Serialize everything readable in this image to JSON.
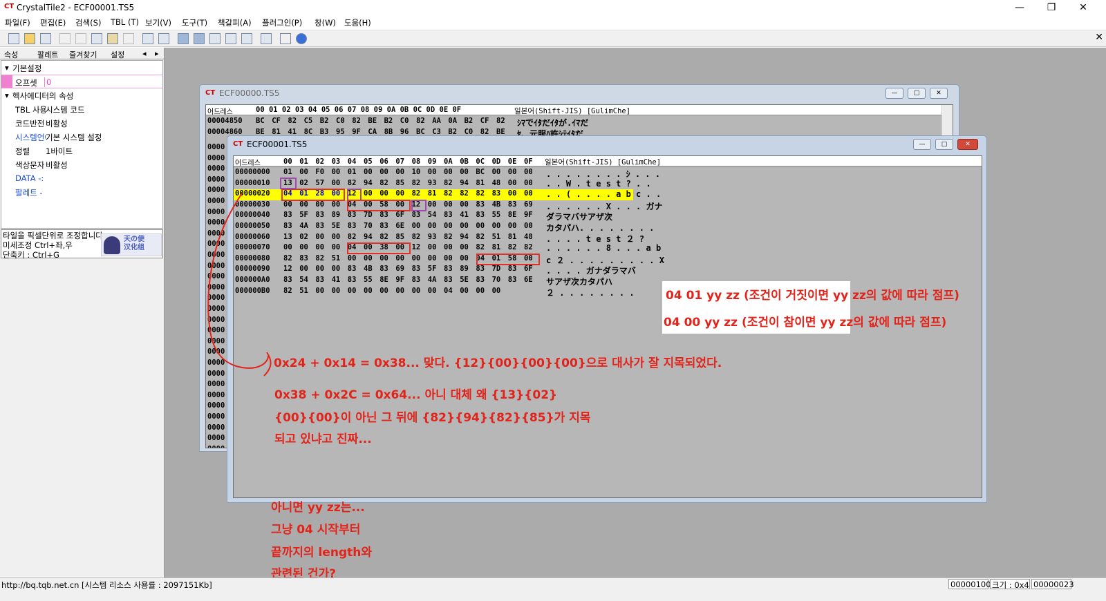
{
  "app": {
    "title": "CrystalTile2 - ECF00001.TS5",
    "logo_text": "CT"
  },
  "window_controls": {
    "minimize": "—",
    "restore": "❐",
    "close": "✕"
  },
  "menu": [
    "파일(F)",
    "편집(E)",
    "검색(S)",
    "TBL (T)",
    "보기(V)",
    "도구(T)",
    "책갈피(A)",
    "플러그인(P)",
    "창(W)",
    "도움(H)"
  ],
  "toolbar": {
    "icons": [
      "new-icon",
      "open-icon",
      "save-icon",
      "undo-icon",
      "cut-icon",
      "copy-icon",
      "paste-icon",
      "delete-icon",
      "import-icon",
      "export-icon",
      "hex-view-icon",
      "tile-view-icon",
      "text-view-icon",
      "edit-icon",
      "search-icon",
      "print-icon",
      "grid-icon",
      "help-icon"
    ],
    "mdi_close": "✕"
  },
  "left_panel": {
    "tabs": [
      "속성",
      "팔레트",
      "즐겨찾기",
      "설정"
    ],
    "tab_arrows": [
      "◂",
      "▸"
    ],
    "properties": {
      "cat_basic": "기본설정",
      "offset_key": "오프셋",
      "offset_val": "0",
      "cat_hex": "헥사에디터의 속성",
      "rows": [
        {
          "key": "TBL 사용",
          "val": "시스템 코드",
          "blue": false
        },
        {
          "key": "코드반전",
          "val": "비활성",
          "blue": false
        },
        {
          "key": "시스템언어",
          "val": "기본 시스템 설정",
          "blue": true
        },
        {
          "key": "정렬",
          "val": "1바이트",
          "blue": false
        },
        {
          "key": "색상문자",
          "val": "비활성",
          "blue": false
        },
        {
          "key": "DATA -:",
          "val": "",
          "blue": true
        },
        {
          "key": "팔레트 -",
          "val": "",
          "blue": true
        }
      ]
    },
    "hint": {
      "lines": [
        "타일을 픽셀단위로 조정합니다.",
        "미세조정 Ctrl+좌,우",
        "단축키 : Ctrl+G"
      ],
      "logo_text": "天の使\n汉化组"
    }
  },
  "window_back": {
    "title": "ECF00000.TS5",
    "header_addr": "어드레스",
    "header_chars": "일본어(Shift-JIS) [GulimChe]",
    "lines": [
      {
        "addr": "00004850",
        "bytes": [
          "BC",
          "CF",
          "82",
          "C5",
          "B2",
          "C0",
          "82",
          "BE",
          "B2",
          "C0",
          "82",
          "AA",
          "0A",
          "B2",
          "CF",
          "82"
        ],
        "text": "ｼﾏでｲﾀだｲﾀが.ｲﾏだ"
      },
      {
        "addr": "00004860",
        "bytes": [
          "BE",
          "81",
          "41",
          "8C",
          "B3",
          "95",
          "9F",
          "CA",
          "8B",
          "96",
          "BC",
          "C3",
          "B2",
          "C0",
          "82",
          "BE"
        ],
        "text": "ｾ、元服ﾊ許ｼﾃｲﾀだ"
      }
    ],
    "addr_stub": "0000"
  },
  "window_front": {
    "title": "ECF00001.TS5",
    "header_addr": "어드레스",
    "header_cols": [
      "00",
      "01",
      "02",
      "03",
      "04",
      "05",
      "06",
      "07",
      "08",
      "09",
      "0A",
      "0B",
      "0C",
      "0D",
      "0E",
      "0F"
    ],
    "header_chars": "일본어(Shift-JIS) [GulimChe]",
    "lines": [
      {
        "addr": "00000000",
        "bytes": [
          "01",
          "00",
          "F0",
          "00",
          "01",
          "00",
          "00",
          "00",
          "10",
          "00",
          "00",
          "00",
          "BC",
          "00",
          "00",
          "00"
        ],
        "text": ". . . . . . . . ｼ . . ."
      },
      {
        "addr": "00000010",
        "bytes": [
          "13",
          "02",
          "57",
          "00",
          "82",
          "94",
          "82",
          "85",
          "82",
          "93",
          "82",
          "94",
          "81",
          "48",
          "00",
          "00"
        ],
        "text": ". . W . t e s t ? . ."
      },
      {
        "addr": "00000020",
        "bytes": [
          "04",
          "01",
          "28",
          "00",
          "12",
          "00",
          "00",
          "00",
          "82",
          "81",
          "82",
          "82",
          "82",
          "83",
          "00",
          "00"
        ],
        "text": ". . ( . . . . a b c . ."
      },
      {
        "addr": "00000030",
        "bytes": [
          "00",
          "00",
          "00",
          "00",
          "04",
          "00",
          "58",
          "00",
          "12",
          "00",
          "00",
          "00",
          "83",
          "4B",
          "83",
          "69"
        ],
        "text": ". . . . . . X . . . ガナ"
      },
      {
        "addr": "00000040",
        "bytes": [
          "83",
          "5F",
          "83",
          "89",
          "83",
          "7D",
          "83",
          "6F",
          "83",
          "54",
          "83",
          "41",
          "83",
          "55",
          "8E",
          "9F"
        ],
        "text": "ダラマバサアザ次"
      },
      {
        "addr": "00000050",
        "bytes": [
          "83",
          "4A",
          "83",
          "5E",
          "83",
          "70",
          "83",
          "6E",
          "00",
          "00",
          "00",
          "00",
          "00",
          "00",
          "00",
          "00"
        ],
        "text": "カタパハ. . . . . . . ."
      },
      {
        "addr": "00000060",
        "bytes": [
          "13",
          "02",
          "00",
          "00",
          "82",
          "94",
          "82",
          "85",
          "82",
          "93",
          "82",
          "94",
          "82",
          "51",
          "81",
          "48"
        ],
        "text": ". . . . t e s t ２ ?"
      },
      {
        "addr": "00000070",
        "bytes": [
          "00",
          "00",
          "00",
          "00",
          "04",
          "00",
          "38",
          "00",
          "12",
          "00",
          "00",
          "00",
          "82",
          "81",
          "82",
          "82"
        ],
        "text": ". . . . . . 8 . . . a b"
      },
      {
        "addr": "00000080",
        "bytes": [
          "82",
          "83",
          "82",
          "51",
          "00",
          "00",
          "00",
          "00",
          "00",
          "00",
          "00",
          "00",
          "04",
          "01",
          "58",
          "00"
        ],
        "text": "c ２ . . . . . . . . . X"
      },
      {
        "addr": "00000090",
        "bytes": [
          "12",
          "00",
          "00",
          "00",
          "83",
          "4B",
          "83",
          "69",
          "83",
          "5F",
          "83",
          "89",
          "83",
          "7D",
          "83",
          "6F"
        ],
        "text": ". . . . ガナダラマバ"
      },
      {
        "addr": "000000A0",
        "bytes": [
          "83",
          "54",
          "83",
          "41",
          "83",
          "55",
          "8E",
          "9F",
          "83",
          "4A",
          "83",
          "5E",
          "83",
          "70",
          "83",
          "6E"
        ],
        "text": "サアザ次カタパハ"
      },
      {
        "addr": "000000B0",
        "bytes": [
          "82",
          "51",
          "00",
          "00",
          "00",
          "00",
          "00",
          "00",
          "00",
          "00",
          "04",
          "00",
          "00",
          "00",
          "",
          ""
        ],
        "text": "２ . . . . . . . ."
      }
    ]
  },
  "annotations": {
    "legend_line1": "04 01 yy zz (조건이 거짓이면 yy zz의 값에 따라 점프)",
    "legend_line2": "04 00 yy zz (조건이 참이면 yy zz의 값에 따라 점프)",
    "note1": "0x24 + 0x14 = 0x38... 맞다. {12}{00}{00}{00}으로 대사가 잘 지목되었다.",
    "note2_l1": "0x38 + 0x2C = 0x64... 아니 대체 왜 {13}{02}",
    "note2_l2": "{00}{00}이 아닌 그 뒤에 {82}{94}{82}{85}가 지목",
    "note2_l3": "되고 있냐고 진짜...",
    "note3_l1": "아니면 yy zz는...",
    "note3_l2": "그냥 04 시작부터",
    "note3_l3": "끝까지의 length와",
    "note3_l4": "관련된 건가?",
    "color": "#e2231a"
  },
  "status": {
    "main": "http://bq.tqb.net.cn [시스템 리소스 사용률 : 2097151Kb]",
    "pos": "00000100",
    "size": "크기 : 0x4",
    "sel": "00000023"
  }
}
